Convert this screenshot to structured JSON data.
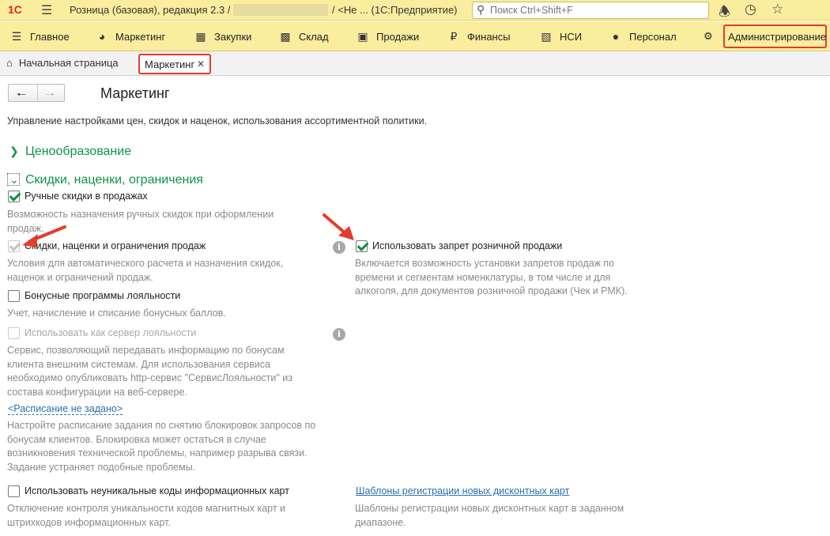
{
  "titlebar": {
    "logo": "1С",
    "title": "Розница (базовая), редакция 2.3 /",
    "title_tail": "/ <Не ...   (1С:Предприятие)",
    "search_placeholder": "Поиск Ctrl+Shift+F",
    "icons": [
      "menu-icon",
      "bell-icon",
      "history-icon",
      "star-icon"
    ]
  },
  "sections": [
    {
      "label": "Главное",
      "icon": "menu-icon"
    },
    {
      "label": "Маркетинг",
      "icon": "pie-icon"
    },
    {
      "label": "Закупки",
      "icon": "grid-icon"
    },
    {
      "label": "Склад",
      "icon": "warehouse-icon"
    },
    {
      "label": "Продажи",
      "icon": "basket-icon"
    },
    {
      "label": "Финансы",
      "icon": "ruble-icon"
    },
    {
      "label": "НСИ",
      "icon": "books-icon"
    },
    {
      "label": "Персонал",
      "icon": "person-icon"
    },
    {
      "label": "Администрирование",
      "icon": "gear-icon"
    }
  ],
  "tabs": {
    "home": "Начальная страница",
    "active": "Маркетинг"
  },
  "page": {
    "title": "Маркетинг",
    "description": "Управление настройками цен, скидок и наценок, использования ассортиментной политики."
  },
  "groups": {
    "pricing": "Ценообразование",
    "discounts": "Скидки, наценки, ограничения"
  },
  "options": {
    "manual_discounts": {
      "label": "Ручные скидки в продажах",
      "checked": true,
      "note": "Возможность назначения ручных скидок при оформлении продаж."
    },
    "auto_discounts": {
      "label": "Скидки, наценки и ограничения продаж",
      "checked": true,
      "disabled": true,
      "note": "Условия для автоматического расчета и назначения скидок, наценок и ограничений продаж."
    },
    "retail_ban": {
      "label": "Использовать запрет розничной продажи",
      "checked": true,
      "note": "Включается возможность установки запретов продаж по времени и сегментам номенклатуры, в том числе и для алкоголя, для документов розничной продажи (Чек и РМК)."
    },
    "bonus": {
      "label": "Бонусные программы лояльности",
      "checked": false,
      "note": "Учет, начисление и списание бонусных баллов."
    },
    "loyalty_server": {
      "label": "Использовать как сервер лояльности",
      "checked": false,
      "disabled": true,
      "note": "Сервис, позволяющий передавать информацию по бонусам клиента внешним системам. Для использования сервиса необходимо опубликовать http-сервис \"СервисЛояльности\" из состава конфигурации на веб-сервере."
    },
    "schedule": {
      "link": "<Расписание не задано>",
      "note": "Настройте расписание задания по снятию блокировок запросов по бонусам клиентов. Блокировка может остаться в случае возникновения технической проблемы, например разрыва связи. Задание устраняет подобные проблемы."
    },
    "nonunique_cards": {
      "label": "Использовать неуникальные коды информационных карт",
      "checked": false,
      "note": "Отключение контроля уникальности кодов магнитных карт и штрихкодов информационных карт."
    },
    "card_templates": {
      "link": "Шаблоны регистрации новых дисконтных карт",
      "note": "Шаблоны регистрации новых дисконтных карт в заданном диапазоне."
    }
  },
  "colors": {
    "accent_green": "#0d9446",
    "highlight_red": "#e23c2e",
    "panel_yellow": "#fbed9e"
  }
}
